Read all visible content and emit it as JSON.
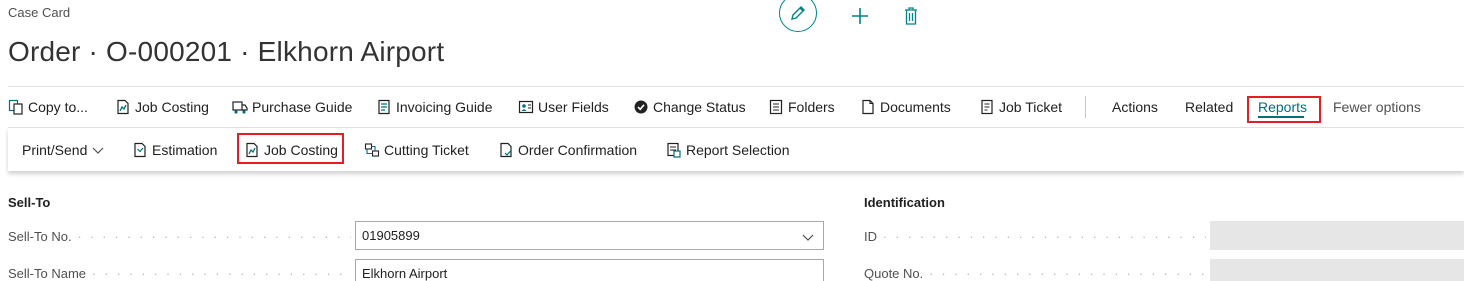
{
  "page": {
    "caption": "Case Card",
    "title": "Order · O-000201 · Elkhorn Airport"
  },
  "top_actions": {
    "edit_icon": "pencil-icon",
    "add_icon": "plus-icon",
    "delete_icon": "trash-icon",
    "accent": "#008489"
  },
  "action_bar": {
    "items": [
      {
        "label": "Copy to...",
        "icon": "copy-icon"
      },
      {
        "label": "Job Costing",
        "icon": "chart-doc-icon"
      },
      {
        "label": "Purchase Guide",
        "icon": "truck-icon"
      },
      {
        "label": "Invoicing Guide",
        "icon": "invoice-icon"
      },
      {
        "label": "User Fields",
        "icon": "user-fields-icon"
      },
      {
        "label": "Change Status",
        "icon": "status-icon"
      },
      {
        "label": "Folders",
        "icon": "folders-icon"
      },
      {
        "label": "Documents",
        "icon": "document-icon"
      },
      {
        "label": "Job Ticket",
        "icon": "ticket-icon"
      }
    ],
    "actions": "Actions",
    "related": "Related",
    "reports": "Reports",
    "fewer_options": "Fewer options"
  },
  "sub_bar": {
    "print_send": "Print/Send",
    "items": [
      {
        "label": "Estimation",
        "icon": "estimation-icon"
      },
      {
        "label": "Job Costing",
        "icon": "chart-doc-icon"
      },
      {
        "label": "Cutting Ticket",
        "icon": "cutting-icon"
      },
      {
        "label": "Order Confirmation",
        "icon": "confirm-doc-icon"
      },
      {
        "label": "Report Selection",
        "icon": "report-selection-icon"
      }
    ]
  },
  "sell_to": {
    "title": "Sell-To",
    "no_label": "Sell-To No.",
    "no_value": "01905899",
    "name_label": "Sell-To Name",
    "name_value": "Elkhorn Airport"
  },
  "identification": {
    "title": "Identification",
    "id_label": "ID",
    "quote_label": "Quote No."
  },
  "colors": {
    "highlight_box": "#e31e24",
    "reports_active": "#00727a"
  }
}
